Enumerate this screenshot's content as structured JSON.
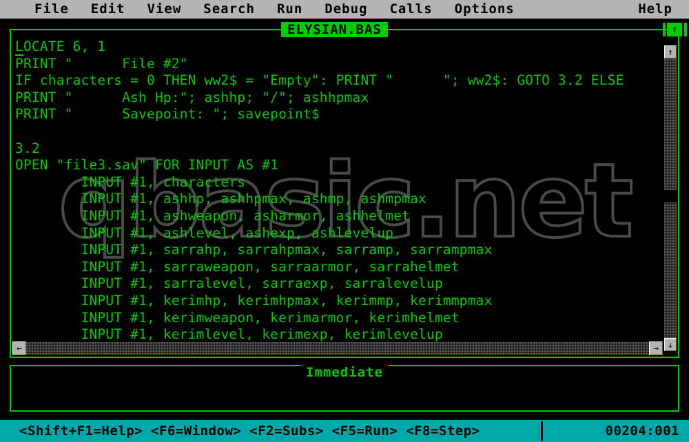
{
  "app": {
    "name": "QBasic IDE",
    "theme": {
      "menubar_bg": "#b4b4b4",
      "menubar_fg": "#000000",
      "screen_bg": "#000000",
      "code_fg": "#00cc00",
      "window_border": "#00cc00",
      "title_bg": "#00cc00",
      "title_fg": "#000000",
      "statusbar_bg": "#00a8a8",
      "statusbar_fg": "#000000",
      "scrollbar_face": "#b4b4b4",
      "watermark": "#4a4a4a"
    }
  },
  "menubar": {
    "items": [
      {
        "label": "File"
      },
      {
        "label": "Edit"
      },
      {
        "label": "View"
      },
      {
        "label": "Search"
      },
      {
        "label": "Run"
      },
      {
        "label": "Debug"
      },
      {
        "label": "Calls"
      },
      {
        "label": "Options"
      }
    ],
    "help": {
      "label": "Help"
    }
  },
  "code_window": {
    "title": "ELYSIAN.BAS",
    "maximize_glyph": "↑",
    "lines": [
      "LOCATE 6, 1",
      "PRINT \"      File #2\"",
      "IF characters = 0 THEN ww2$ = \"Empty\": PRINT \"      \"; ww2$: GOTO 3.2 ELSE",
      "PRINT \"      Ash Hp:\"; ashhp; \"/\"; ashhpmax",
      "PRINT \"      Savepoint: \"; savepoint$",
      "",
      "3.2",
      "OPEN \"file3.sav\" FOR INPUT AS #1",
      "        INPUT #1, characters",
      "        INPUT #1, ashhp, ashhpmax, ashmp, ashmpmax",
      "        INPUT #1, ashweapon, asharmor, ashhelmet",
      "        INPUT #1, ashlevel, ashexp, ashlevelup",
      "        INPUT #1, sarrahp, sarrahpmax, sarramp, sarrampmax",
      "        INPUT #1, sarraweapon, sarraarmor, sarrahelmet",
      "        INPUT #1, sarralevel, sarraexp, sarralevelup",
      "        INPUT #1, kerimhp, kerimhpmax, kerimmp, kerimmpmax",
      "        INPUT #1, kerimweapon, kerimarmor, kerimhelmet",
      "        INPUT #1, kerimlevel, kerimexp, kerimlevelup"
    ]
  },
  "watermark": {
    "text": "qbasic.net"
  },
  "scrollbars": {
    "vertical": {
      "up_arrow": "↑",
      "down_arrow": "↓"
    },
    "horizontal": {
      "left_arrow": "←",
      "right_arrow": "→"
    }
  },
  "immediate_window": {
    "title": "Immediate",
    "content": ""
  },
  "statusbar": {
    "keys": "<Shift+F1=Help> <F6=Window> <F2=Subs> <F5=Run> <F8=Step>",
    "position": "00204:001"
  }
}
